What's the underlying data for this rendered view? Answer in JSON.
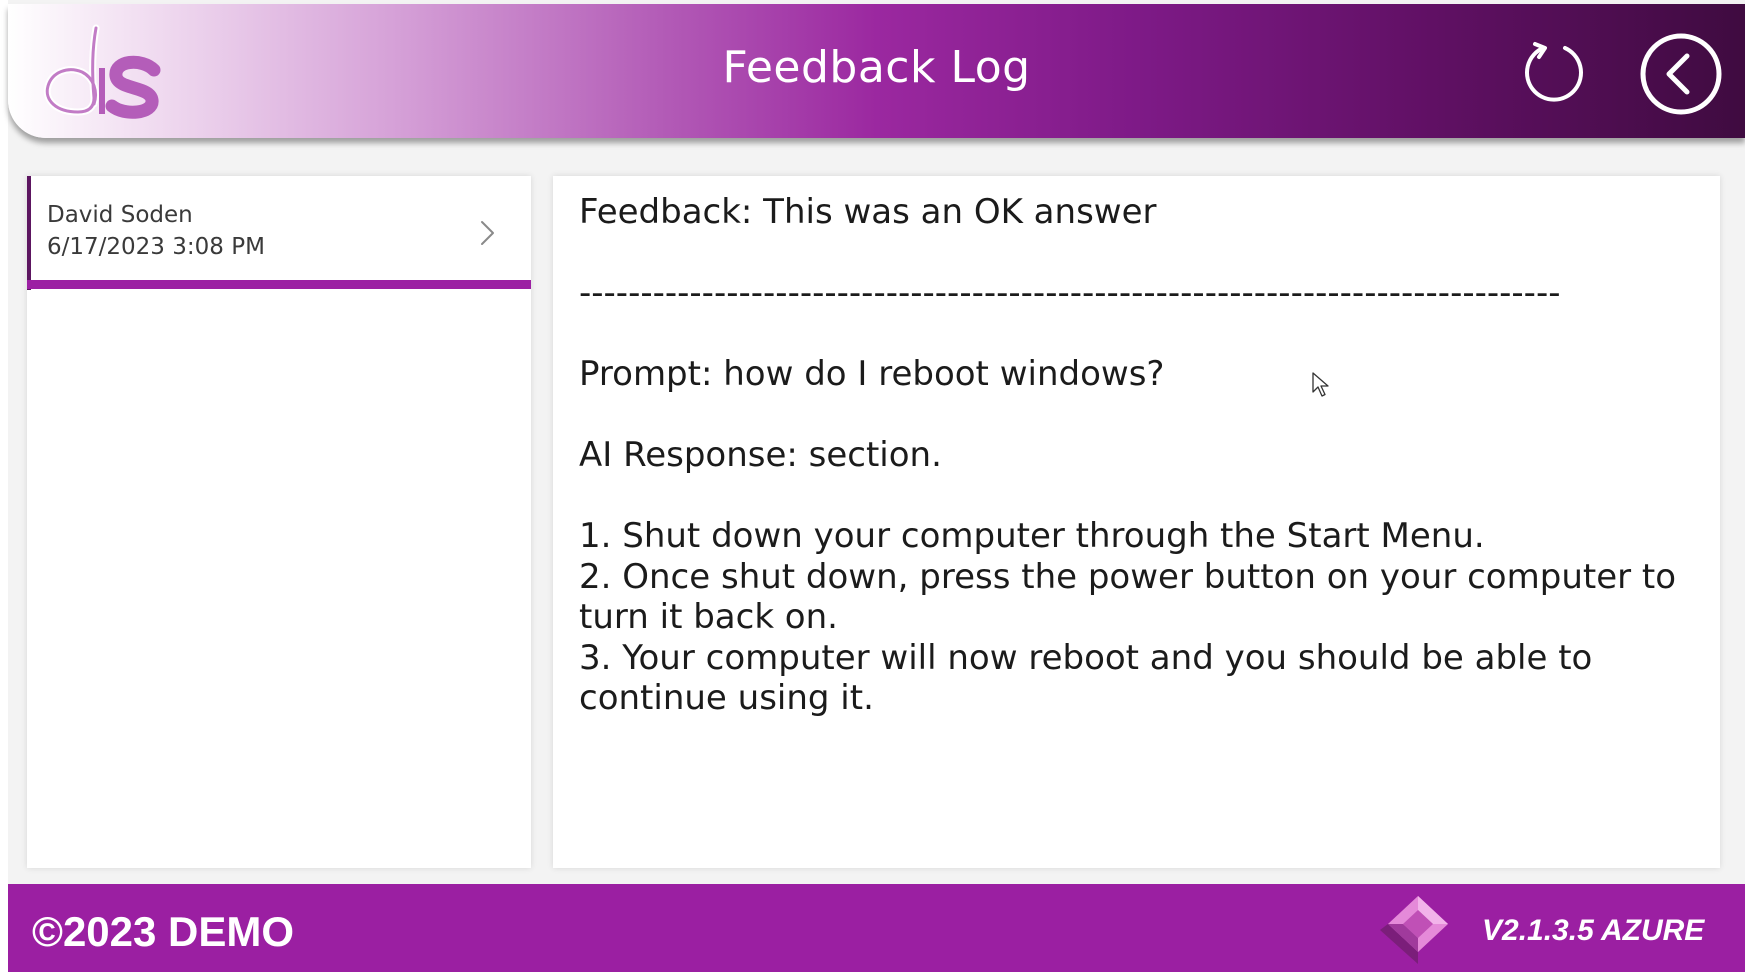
{
  "header": {
    "title": "Feedback Log",
    "logo_icon": "ds-logo-icon",
    "refresh_icon": "refresh-icon",
    "back_icon": "back-arrow-icon"
  },
  "feedback_list": {
    "items": [
      {
        "name": "David Soden",
        "date": "6/17/2023 3:08 PM",
        "selected": true
      }
    ]
  },
  "detail": {
    "text": "Feedback: This was an OK answer\n\n--------------------------------------------------------------------------------\n\nPrompt: how do I reboot windows?\n\nAI Response: section.\n\n1. Shut down your computer through the Start Menu.\n2. Once shut down, press the power button on your computer to turn it back on.\n3. Your computer will now reboot and you should be able to continue using it."
  },
  "footer": {
    "copyright": "©2023 DEMO",
    "version": "V2.1.3.5 AZURE",
    "brand_icon": "power-apps-icon"
  },
  "colors": {
    "accent_purple": "#9b1fa2",
    "dark_purple": "#3f0b40",
    "selection_bar": "#9c20a3"
  }
}
